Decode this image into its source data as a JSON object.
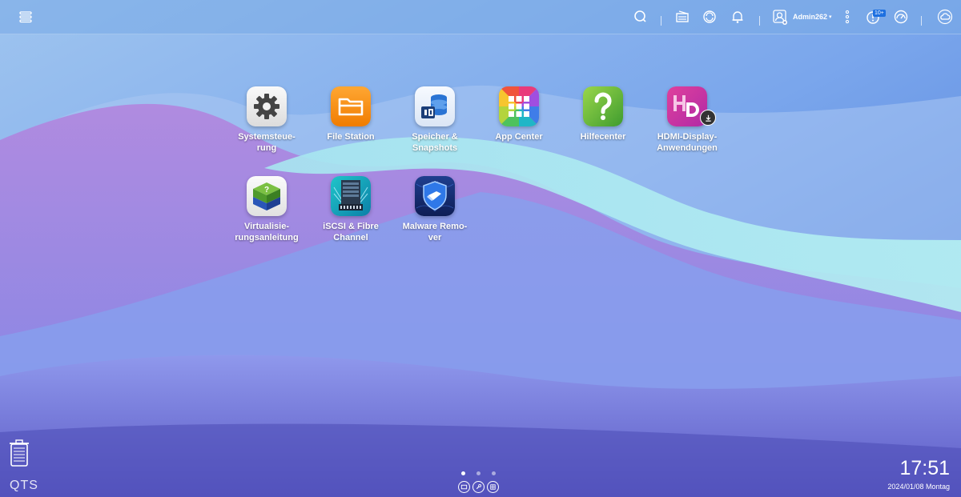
{
  "topbar": {
    "user_name": "Admin262",
    "notification_badge": "10+",
    "icons": [
      "menu-icon",
      "search-icon",
      "background-tasks-icon",
      "external-device-icon",
      "bell-icon",
      "user-icon",
      "more-icon",
      "dashboard-icon",
      "resource-monitor-icon",
      "cloud-icon"
    ]
  },
  "apps": [
    {
      "line1": "Systemsteue-",
      "line2": "rung",
      "icon": "gear-icon"
    },
    {
      "line1": "File Station",
      "line2": "",
      "icon": "folder-icon"
    },
    {
      "line1": "Speicher &",
      "line2": "Snapshots",
      "icon": "storage-icon"
    },
    {
      "line1": "App Center",
      "line2": "",
      "icon": "app-grid-icon"
    },
    {
      "line1": "Hilfecenter",
      "line2": "",
      "icon": "question-icon"
    },
    {
      "line1": "HDMI-Display-",
      "line2": "Anwendungen",
      "icon": "hd-icon"
    },
    {
      "line1": "Virtualisie-",
      "line2": "rungsanleitung",
      "icon": "virtual-cube-icon"
    },
    {
      "line1": "iSCSI & Fibre",
      "line2": "Channel",
      "icon": "server-icon"
    },
    {
      "line1": "Malware Remo-",
      "line2": "ver",
      "icon": "shield-icon"
    }
  ],
  "bottom": {
    "logo": "QTS",
    "time": "17:51",
    "date": "2024/01/08 Montag",
    "pages": 3,
    "active_page": 1
  },
  "colors": {
    "topbar": "#7eaae6",
    "accent": "#1c6fe0"
  }
}
